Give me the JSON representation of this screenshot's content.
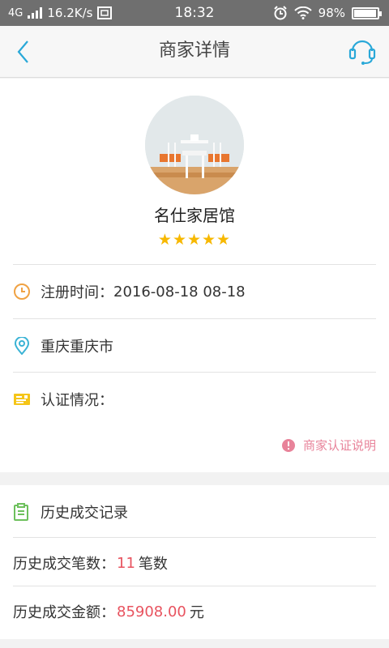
{
  "status_bar": {
    "network": "4G",
    "speed": "16.2K/s",
    "time": "18:32",
    "battery": "98%",
    "battery_level": 0.98
  },
  "nav": {
    "title": "商家详情"
  },
  "merchant": {
    "name": "名仕家居馆",
    "stars": "★★★★★",
    "rating": 5,
    "register_label": "注册时间：",
    "register_time": "2016-08-18 08-18",
    "location": "重庆重庆市",
    "certification_label": "认证情况：",
    "cert_note": "商家认证说明"
  },
  "history": {
    "title": "历史成交记录",
    "count_label": "历史成交笔数：",
    "count_value": "11",
    "count_unit": "笔数",
    "amount_label": "历史成交金额：",
    "amount_value": "85908.00",
    "amount_unit": "元"
  },
  "colors": {
    "accent": "#29a8d8",
    "star": "#f7b800",
    "highlight": "#e8535f",
    "note": "#e8839a",
    "clock_icon": "#f0a243",
    "location_icon": "#3ab3d5",
    "cert_icon": "#f5c518",
    "history_icon": "#6dc05c"
  }
}
